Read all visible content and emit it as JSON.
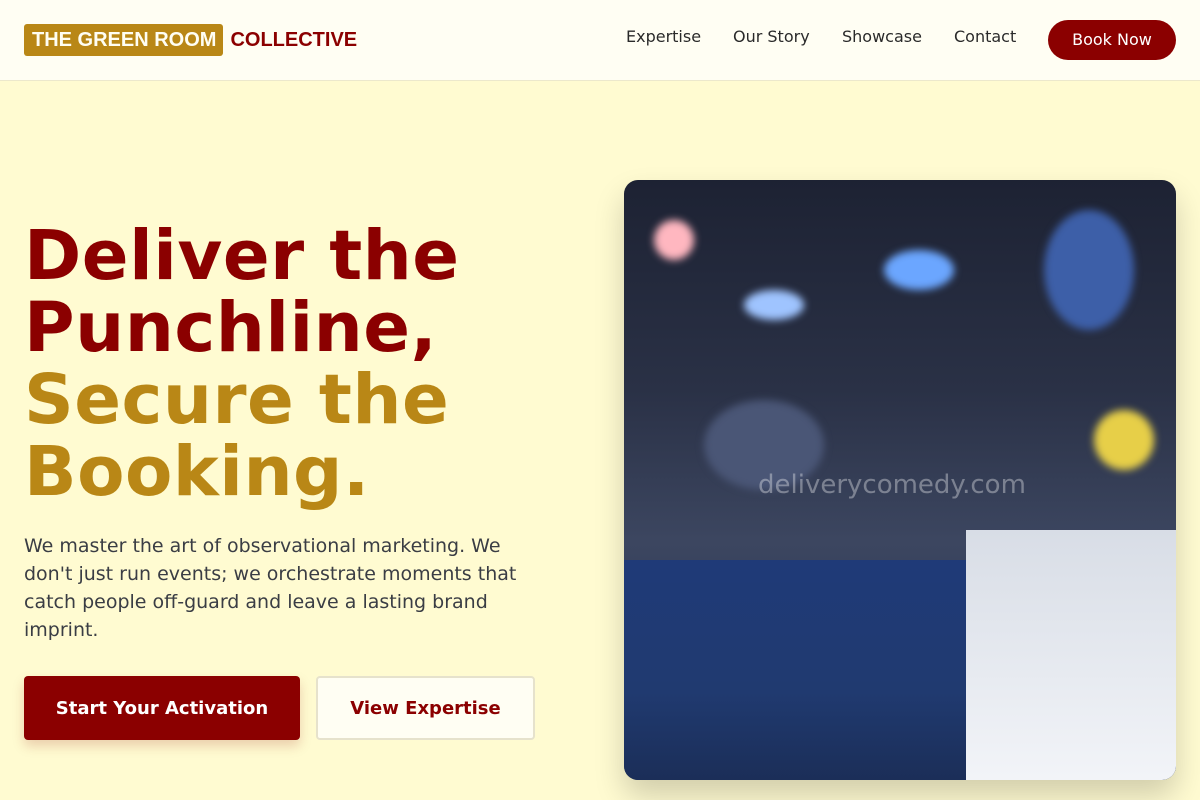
{
  "header": {
    "logo_badge": "THE GREEN ROOM",
    "logo_text": "COLLECTIVE",
    "nav": [
      "Expertise",
      "Our Story",
      "Showcase",
      "Contact"
    ],
    "book_label": "Book Now"
  },
  "hero": {
    "headline_lines": [
      "Deliver the",
      "Punchline,",
      "Secure the",
      "Booking."
    ],
    "subtext": "We master the art of observational marketing. We don't just run events; we orchestrate moments that catch people off-guard and leave a lasting brand imprint.",
    "cta_primary": "Start Your Activation",
    "cta_secondary": "View Expertise",
    "image_watermark": "deliverycomedy.com"
  },
  "colors": {
    "accent_red": "#8b0000",
    "accent_gold": "#b98716",
    "background": "#fffbd1"
  }
}
